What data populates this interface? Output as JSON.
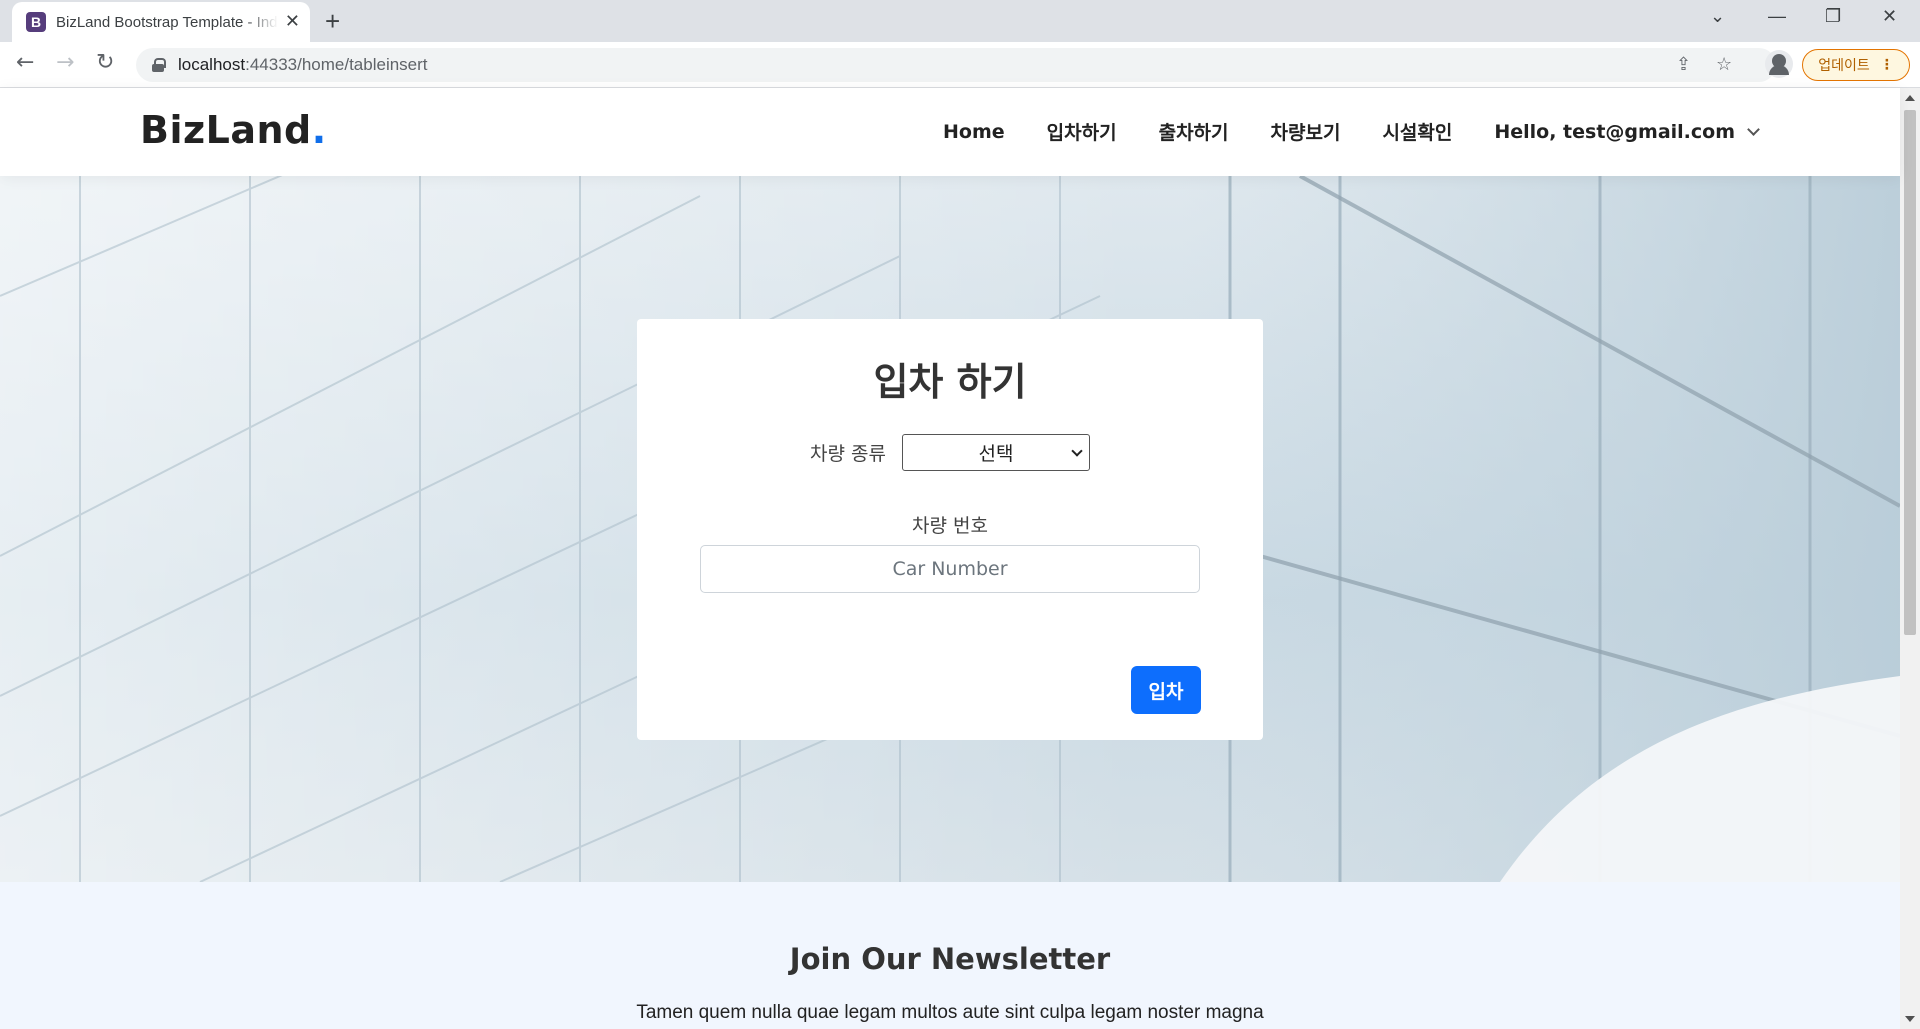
{
  "browser": {
    "tab_title": "BizLand Bootstrap Template - Index",
    "favicon_letter": "B",
    "new_tab": "+",
    "url_host": "localhost",
    "url_path": ":44333/home/tableinsert",
    "update_label": "업데이트"
  },
  "header": {
    "logo_text": "BizLand",
    "logo_dot": ".",
    "nav": {
      "home": "Home",
      "park_in": "입차하기",
      "park_out": "출차하기",
      "vehicles": "차량보기",
      "facility": "시설확인",
      "user": "Hello, test@gmail.com"
    }
  },
  "form": {
    "title": "입차 하기",
    "vehicle_type_label": "차량 종류",
    "vehicle_type_value": "선택",
    "vehicle_number_label": "차량 번호",
    "vehicle_number_placeholder": "Car Number",
    "submit_label": "입차"
  },
  "newsletter": {
    "title": "Join Our Newsletter",
    "text": "Tamen quem nulla quae legam multos aute sint culpa legam noster magna"
  },
  "colors": {
    "accent": "#106eea",
    "button": "#0d6efd",
    "newsletter_bg": "#f1f6fe"
  }
}
